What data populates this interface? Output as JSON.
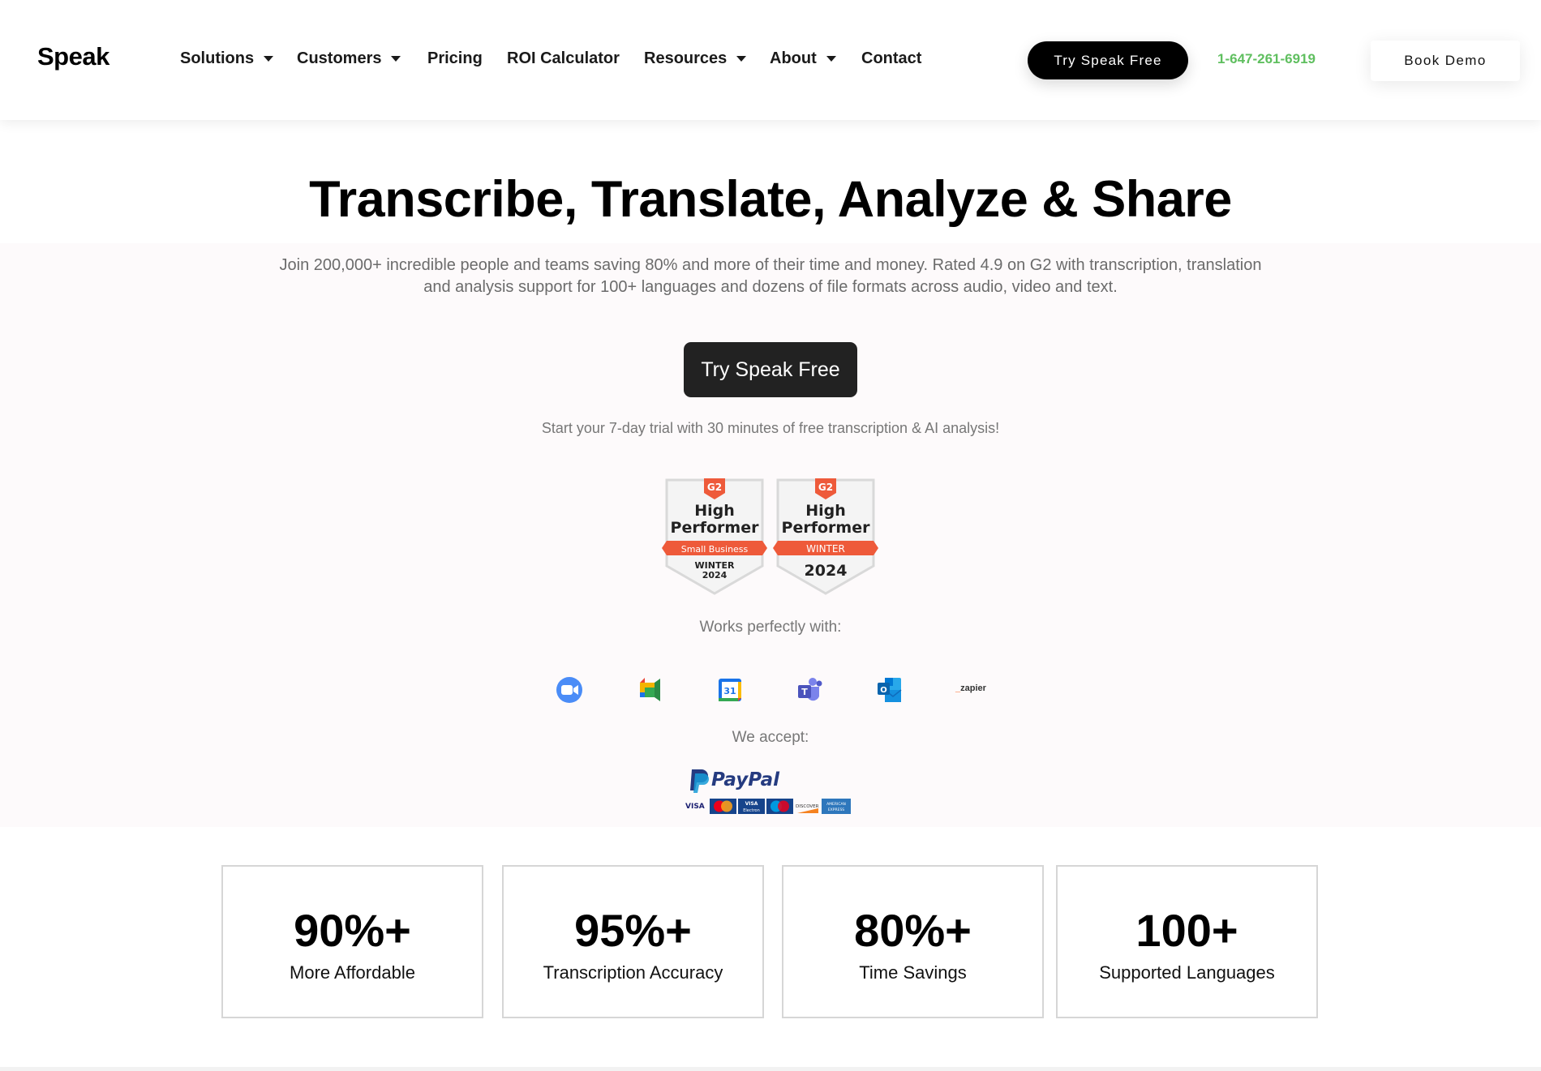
{
  "header": {
    "logo": "Speak",
    "nav": [
      {
        "label": "Solutions",
        "has_dropdown": true
      },
      {
        "label": "Customers",
        "has_dropdown": true
      },
      {
        "label": "Pricing",
        "has_dropdown": false
      },
      {
        "label": "ROI Calculator",
        "has_dropdown": false
      },
      {
        "label": "Resources",
        "has_dropdown": true
      },
      {
        "label": "About",
        "has_dropdown": true
      },
      {
        "label": "Contact",
        "has_dropdown": false
      }
    ],
    "try_free_label": "Try Speak Free",
    "phone": "1-647-261-6919",
    "book_demo_label": "Book Demo"
  },
  "hero": {
    "title": "Transcribe, Translate, Analyze & Share",
    "subtitle": "Join 200,000+ incredible people and teams saving 80% and more of their time and money. Rated 4.9 on G2 with transcription, translation and analysis support for 100+ languages and dozens of file formats across audio, video and text.",
    "cta_label": "Try Speak Free",
    "trial_text": "Start your 7-day trial with 30 minutes of free transcription & AI analysis!"
  },
  "badges": [
    {
      "brand": "G2",
      "line1": "High",
      "line2": "Performer",
      "ribbon": "Small Business",
      "season": "WINTER",
      "year": "2024"
    },
    {
      "brand": "G2",
      "line1": "High",
      "line2": "Performer",
      "ribbon": "WINTER",
      "season": "",
      "year": "2024"
    }
  ],
  "integrations": {
    "label": "Works perfectly with:",
    "items": [
      {
        "name": "zoom-icon",
        "title": "Zoom"
      },
      {
        "name": "google-meet-icon",
        "title": "Google Meet"
      },
      {
        "name": "google-calendar-icon",
        "title": "Google Calendar",
        "text": "31"
      },
      {
        "name": "microsoft-teams-icon",
        "title": "Microsoft Teams",
        "text": "T"
      },
      {
        "name": "outlook-icon",
        "title": "Outlook",
        "text": "O"
      },
      {
        "name": "zapier-icon",
        "title": "Zapier",
        "text": "zapier"
      }
    ]
  },
  "payments": {
    "label": "We accept:",
    "paypal": "PayPal",
    "cards": [
      "VISA",
      "MasterCard",
      "VISA Electron",
      "Maestro",
      "DISCOVER",
      "AMERICAN EXPRESS"
    ]
  },
  "stats": [
    {
      "value": "90%+",
      "label": "More Affordable"
    },
    {
      "value": "95%+",
      "label": "Transcription Accuracy"
    },
    {
      "value": "80%+",
      "label": "Time Savings"
    },
    {
      "value": "100+",
      "label": "Supported Languages"
    }
  ],
  "colors": {
    "accent_green": "#5fbf5f",
    "g2_red": "#ee5a3a",
    "cta_dark": "#222222"
  }
}
